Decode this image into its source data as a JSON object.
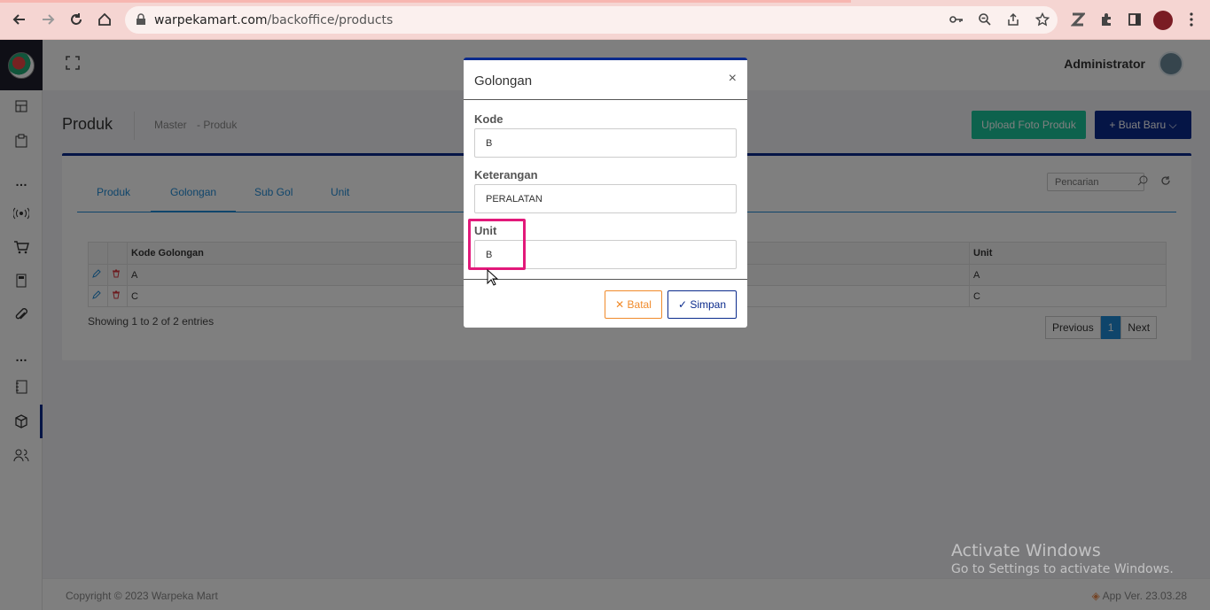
{
  "browser": {
    "url_host": "warpekamart.com",
    "url_path": "/backoffice/products"
  },
  "topbar": {
    "user_name": "Administrator"
  },
  "page": {
    "title": "Produk",
    "breadcrumb": [
      "Master",
      "- Produk"
    ],
    "upload_button": "Upload Foto Produk",
    "new_button": "+ Buat Baru"
  },
  "tabs": [
    "Produk",
    "Golongan",
    "Sub Gol",
    "Unit"
  ],
  "search": {
    "placeholder": "Pencarian"
  },
  "table": {
    "columns": [
      "Kode Golongan",
      "Unit"
    ],
    "rows": [
      {
        "kode": "A",
        "unit": "A"
      },
      {
        "kode": "C",
        "unit": "C"
      }
    ],
    "entries": "Showing 1 to 2 of 2 entries"
  },
  "pager": {
    "prev": "Previous",
    "current": "1",
    "next": "Next"
  },
  "footer": {
    "copyright": "Copyright © 2023 Warpeka Mart",
    "version": "App Ver. 23.03.28"
  },
  "modal": {
    "title": "Golongan",
    "close": "×",
    "fields": {
      "kode": {
        "label": "Kode",
        "value": "B"
      },
      "keterangan": {
        "label": "Keterangan",
        "value": "PERALATAN"
      },
      "unit": {
        "label": "Unit",
        "value": "B"
      }
    },
    "cancel": "✕ Batal",
    "save": "✓ Simpan"
  },
  "watermark": {
    "line1": "Activate Windows",
    "line2": "Go to Settings to activate Windows."
  },
  "colors": {
    "primary": "#0a2a8c",
    "accent": "#1f8bd6",
    "success": "#1bc59a",
    "warning": "#f08a2a",
    "highlight": "#e2197a"
  }
}
